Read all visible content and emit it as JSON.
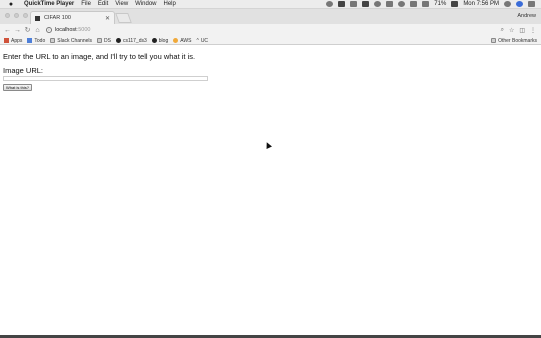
{
  "menubar": {
    "app_name": "QuickTime Player",
    "items": [
      "File",
      "Edit",
      "View",
      "Window",
      "Help"
    ],
    "battery": "71%",
    "clock": "Mon 7:56 PM"
  },
  "browser": {
    "tab_title": "CIFAR 100",
    "user": "Andrew",
    "url_host": "localhost",
    "url_port": ":5000"
  },
  "bookmarks": [
    {
      "label": "Apps",
      "icon": "apps-grid-icon"
    },
    {
      "label": "Todo",
      "icon": "trello-icon"
    },
    {
      "label": "Slack Channels",
      "icon": "folder-icon"
    },
    {
      "label": "DS",
      "icon": "folder-icon"
    },
    {
      "label": "cs117_ds3",
      "icon": "github-icon"
    },
    {
      "label": "blog",
      "icon": "github-icon"
    },
    {
      "label": "AWS",
      "icon": "aws-icon"
    },
    {
      "label": "UC",
      "icon": "caret-icon"
    }
  ],
  "other_bookmarks": "Other Bookmarks",
  "page": {
    "intro": "Enter the URL to an image, and I'll try to tell you what it is.",
    "url_label": "Image URL:",
    "url_value": "",
    "button_label": "What is this?"
  }
}
